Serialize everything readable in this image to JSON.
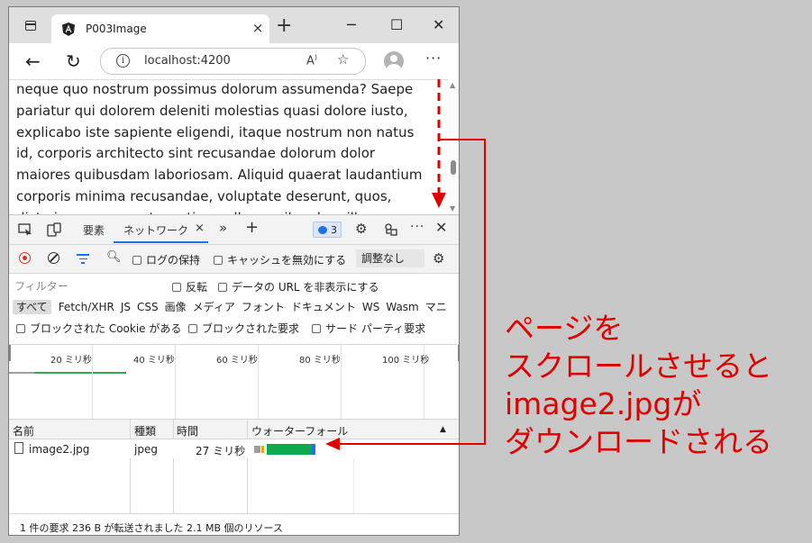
{
  "browser": {
    "tab_title": "P003Image",
    "new_tab": "+",
    "close_tab": "×",
    "url": "localhost:4200",
    "more": "···",
    "window_buttons": {
      "minimize": "─",
      "maximize": "☐",
      "close": "✕"
    }
  },
  "page": {
    "lines": [
      "neque quo nostrum possimus dolorum assumenda? Saepe",
      "pariatur qui dolorem deleniti molestias quasi dolore iusto,",
      "explicabo iste sapiente eligendi, itaque nostrum non natus",
      "id, corporis architecto sint recusandae dolorum dolor",
      "maiores quibusdam laboriosam. Aliquid quaerat laudantium",
      "corporis minima recusandae, voluptate deserunt, quos,",
      "dicta iure consequatur ratione ullam quibusdam illum"
    ]
  },
  "devtools": {
    "tabs": {
      "elements": "要素",
      "network": "ネットワーク",
      "more": "»",
      "add": "+"
    },
    "issues_count": "3",
    "toolbar": {
      "preserve_log": "ログの保持",
      "disable_cache": "キャッシュを無効にする",
      "throttle": "調整なし"
    },
    "filter": {
      "placeholder": "フィルター",
      "invert": "反転",
      "hide_data_urls": "データの URL を非表示にする"
    },
    "types": [
      "すべて",
      "Fetch/XHR",
      "JS",
      "CSS",
      "画像",
      "メディア",
      "フォント",
      "ドキュメント",
      "WS",
      "Wasm",
      "マニ"
    ],
    "blocked": {
      "blocked_cookies": "ブロックされた Cookie がある",
      "blocked_requests": "ブロックされた要求",
      "third_party": "サード パーティ要求"
    },
    "timeline_ticks": [
      "20 ミリ秒",
      "40 ミリ秒",
      "60 ミリ秒",
      "80 ミリ秒",
      "100 ミリ秒"
    ],
    "columns": {
      "name": "名前",
      "type": "種類",
      "time": "時間",
      "waterfall": "ウォーターフォール"
    },
    "rows": [
      {
        "name": "image2.jpg",
        "type": "jpeg",
        "time": "27 ミリ秒"
      }
    ],
    "status_bar": "1 件の要求  236 B が転送されました  2.1 MB 個のリソース",
    "colors": {
      "accent": "#1a73e8",
      "waterfall_green": "#0ca84d",
      "waterfall_blue": "#1a73e8",
      "record_red": "#d93025"
    }
  },
  "annotation": {
    "lines": [
      "ページを",
      "スクロールさせると",
      "image2.jpgが",
      "ダウンロードされる"
    ],
    "color": "#e00000"
  }
}
